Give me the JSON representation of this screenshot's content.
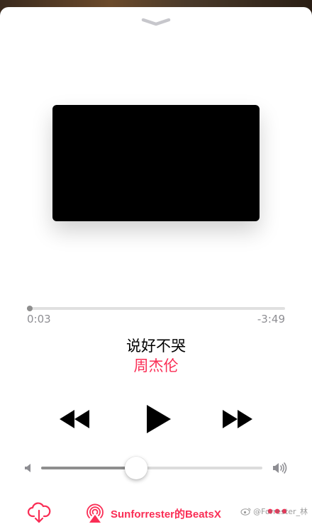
{
  "colors": {
    "accent": "#fa2d55",
    "track_fill": "#8e8e8e",
    "track_bg": "#e0e0e0",
    "text_secondary": "#8e8e93"
  },
  "icons": {
    "grabber": "chevron-down-icon",
    "rewind": "rewind-icon",
    "play": "play-icon",
    "fast_forward": "fast-forward-icon",
    "volume_low": "speaker-low-icon",
    "volume_high": "speaker-high-icon",
    "download": "cloud-download-icon",
    "airplay": "airplay-icon",
    "more": "ellipsis-icon"
  },
  "player": {
    "elapsed": "0:03",
    "remaining": "-3:49",
    "progress_fraction": 0.012,
    "song_title": "说好不哭",
    "artist": "周杰伦",
    "volume_fraction": 0.43
  },
  "output": {
    "device_label": "Sunforrester的BeatsX"
  },
  "watermark": {
    "text": "@Forrester_林"
  }
}
